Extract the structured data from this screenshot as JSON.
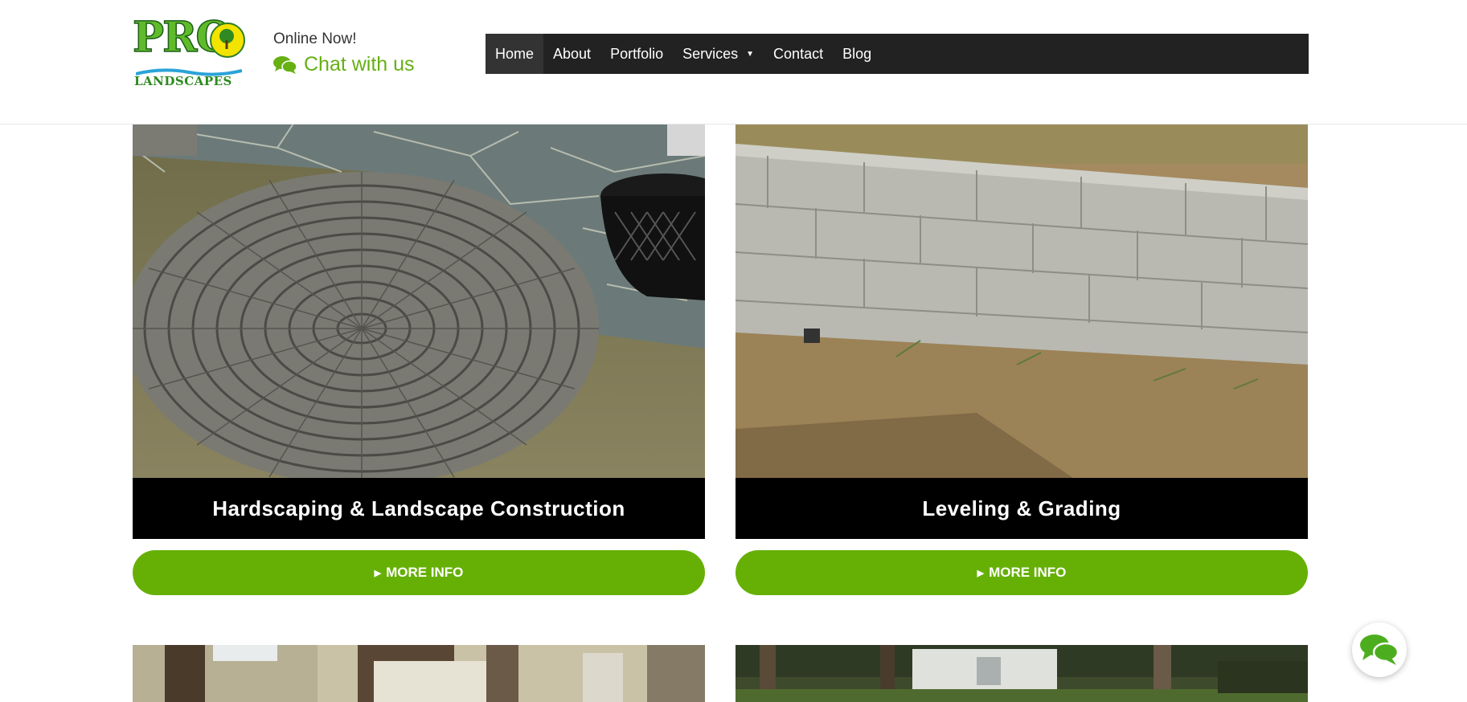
{
  "header": {
    "logo": {
      "word_top": "PRO",
      "word_bottom": "LANDSCAPES"
    },
    "online_status": "Online Now!",
    "chat_label": "Chat with us"
  },
  "nav": {
    "items": [
      {
        "label": "Home",
        "active": true
      },
      {
        "label": "About"
      },
      {
        "label": "Portfolio"
      },
      {
        "label": "Services",
        "has_dropdown": true
      },
      {
        "label": "Contact"
      },
      {
        "label": "Blog"
      }
    ],
    "dropdown_caret": "▼"
  },
  "services": [
    {
      "title": "Hardscaping & Landscape Construction",
      "button": "MORE INFO"
    },
    {
      "title": "Leveling & Grading",
      "button": "MORE INFO"
    }
  ],
  "button_icon": "caret-right-icon",
  "chat_fab_icon": "chat-bubbles-icon",
  "colors": {
    "accent_green": "#66b006",
    "nav_bg": "#222222",
    "caption_bg": "#000000"
  }
}
